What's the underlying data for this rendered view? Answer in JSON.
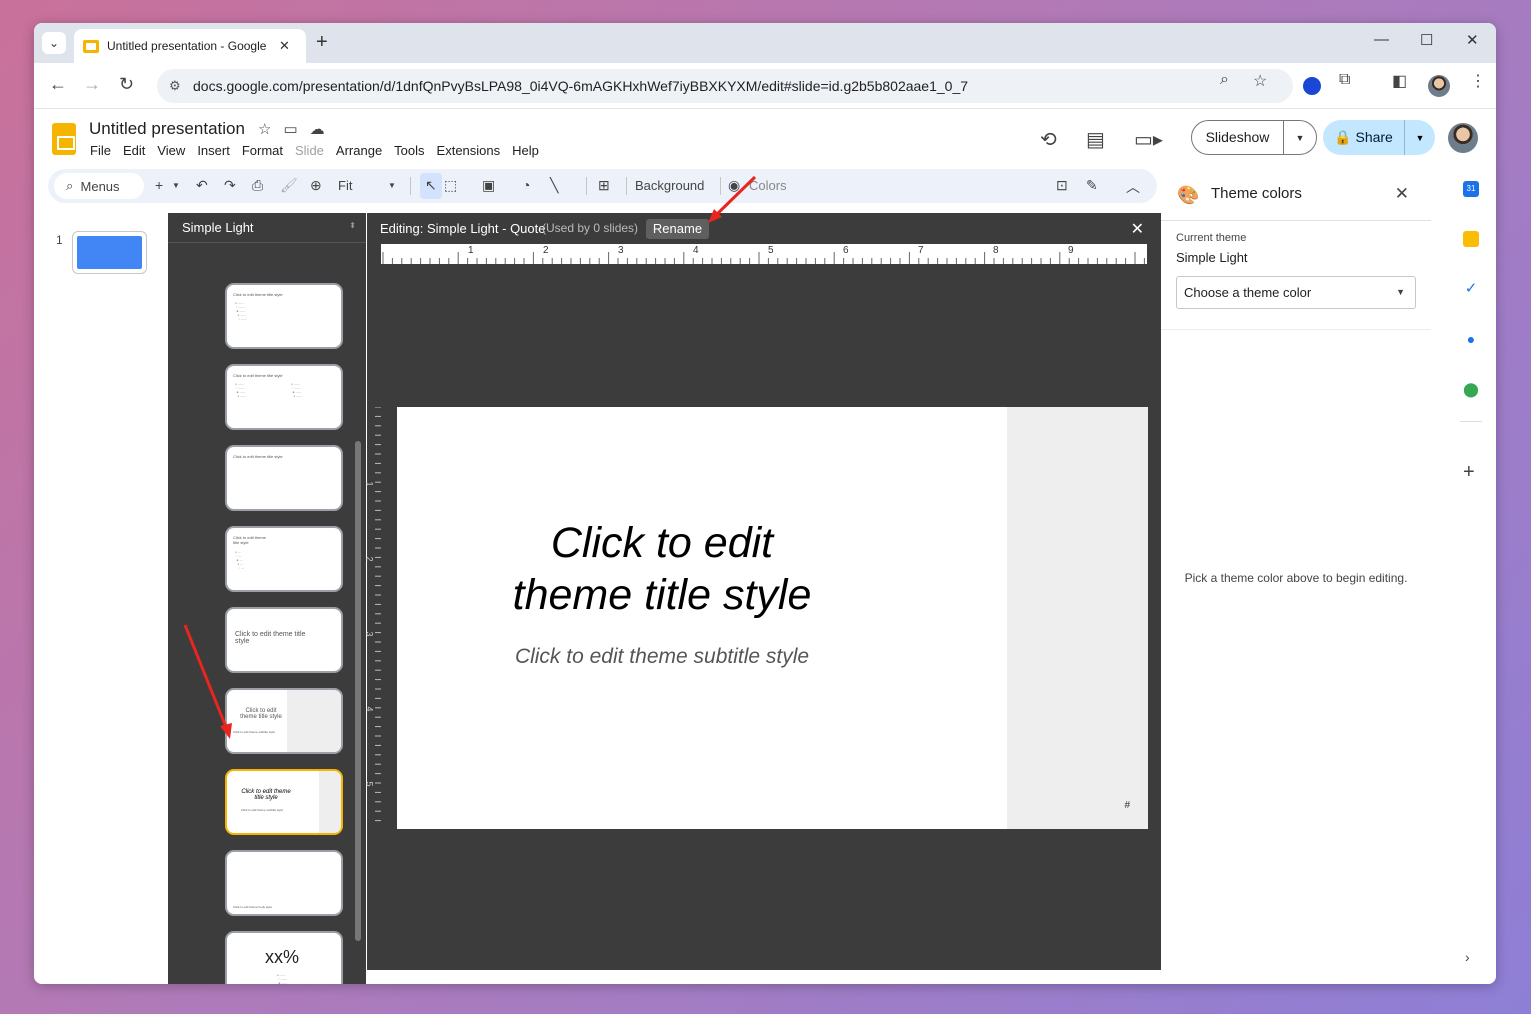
{
  "browser": {
    "tab_title": "Untitled presentation - Google",
    "url": "docs.google.com/presentation/d/1dnfQnPvyBsLPA98_0i4VQ-6mAGKHxhWef7iyBBXKYXM/edit#slide=id.g2b5b802aae1_0_7"
  },
  "docs": {
    "title": "Untitled presentation",
    "menus": [
      "File",
      "Edit",
      "View",
      "Insert",
      "Format",
      "Slide",
      "Arrange",
      "Tools",
      "Extensions",
      "Help"
    ],
    "slideshow_label": "Slideshow",
    "share_label": "Share"
  },
  "toolbar": {
    "menus_label": "Menus",
    "zoom": "Fit",
    "background_label": "Background",
    "colors_label": "Colors"
  },
  "filmstrip": {
    "slide_number": "1"
  },
  "layouts": {
    "theme_name": "Simple Light",
    "items": [
      {
        "title": "Click to edit theme title style",
        "kind": "title-body"
      },
      {
        "title": "Click to edit theme title style",
        "kind": "two-column"
      },
      {
        "title": "Click to edit theme title style",
        "kind": "title-only"
      },
      {
        "title": "Click to edit theme title style",
        "kind": "one-column"
      },
      {
        "title": "Click to edit theme title style",
        "kind": "main-point"
      },
      {
        "title": "Click to edit theme title style",
        "subtitle": "Click to edit theme subtitle style",
        "kind": "section-desc"
      },
      {
        "title": "Click to edit theme title style",
        "subtitle": "Click to edit theme subtitle style",
        "kind": "quote"
      },
      {
        "title": "Click to edit theme body style",
        "kind": "caption"
      },
      {
        "title": "xx%",
        "kind": "big-number"
      }
    ]
  },
  "editor": {
    "editing_title": "Editing: Simple Light - Quote",
    "used_label": "(Used by 0 slides)",
    "rename_label": "Rename",
    "ruler_h": [
      "1",
      "2",
      "3",
      "4",
      "5",
      "6",
      "7",
      "8",
      "9"
    ],
    "ruler_v": [
      "1",
      "2",
      "3",
      "4",
      "5"
    ],
    "slide_title": "Click to edit theme title style",
    "slide_subtitle": "Click to edit theme subtitle style",
    "slide_number_placeholder": "#"
  },
  "theme_panel": {
    "title": "Theme colors",
    "current_theme_label": "Current theme",
    "current_theme_value": "Simple Light",
    "select_label": "Choose a theme color",
    "hint": "Pick a theme color above to begin editing."
  },
  "colors": {
    "accent_yellow": "#f4b400",
    "annotation_red": "#e8261e",
    "share_blue": "#c2e7ff"
  }
}
